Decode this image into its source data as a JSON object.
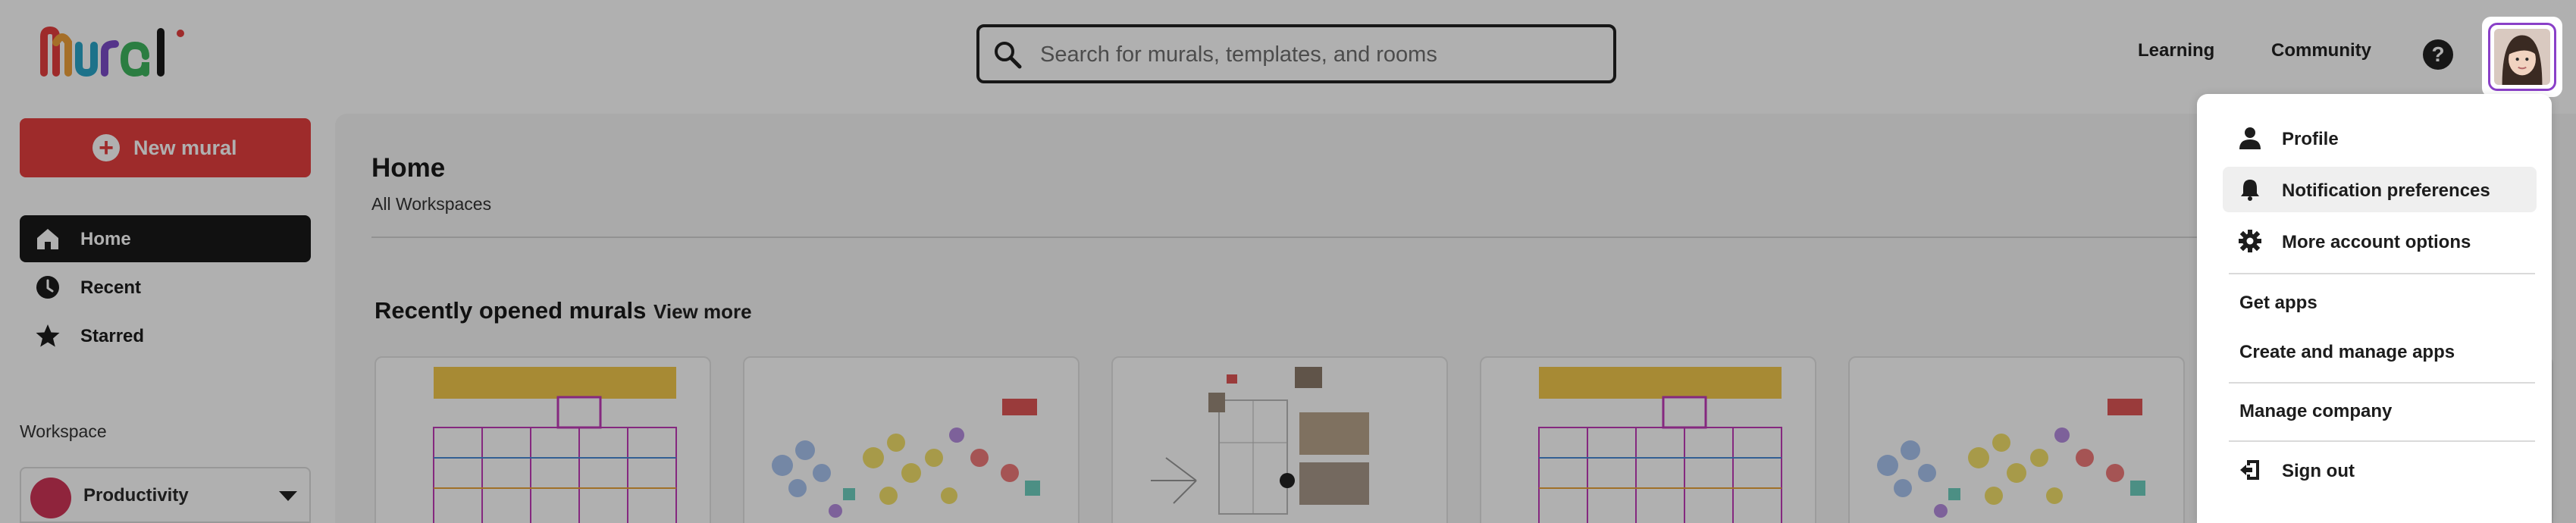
{
  "header": {
    "logo_text": "Mural",
    "search": {
      "placeholder": "Search for murals, templates, and rooms"
    },
    "links": [
      {
        "label": "Learning"
      },
      {
        "label": "Community"
      }
    ],
    "help_label": "?"
  },
  "sidebar": {
    "new_mural_label": "New mural",
    "nav": [
      {
        "label": "Home",
        "icon": "home-icon",
        "active": true
      },
      {
        "label": "Recent",
        "icon": "clock-icon"
      },
      {
        "label": "Starred",
        "icon": "star-icon"
      }
    ],
    "workspace_heading": "Workspace",
    "workspace_name": "Productivity"
  },
  "main": {
    "title": "Home",
    "breadcrumb": "All Workspaces",
    "recent_title": "Recently opened murals",
    "view_more": "View more"
  },
  "account_menu": {
    "items": [
      {
        "label": "Profile",
        "icon": "person-icon"
      },
      {
        "label": "Notification preferences",
        "icon": "bell-icon",
        "hovered": true
      },
      {
        "label": "More account options",
        "icon": "gear-icon"
      },
      {
        "label": "Get apps"
      },
      {
        "label": "Create and manage apps"
      },
      {
        "label": "Manage company"
      },
      {
        "label": "Sign out",
        "icon": "sign-out-icon"
      }
    ]
  },
  "colors": {
    "brand_red": "#e53f3f",
    "avatar_focus": "#8a40c8",
    "overlay": "rgba(0,0,0,0.31)"
  }
}
